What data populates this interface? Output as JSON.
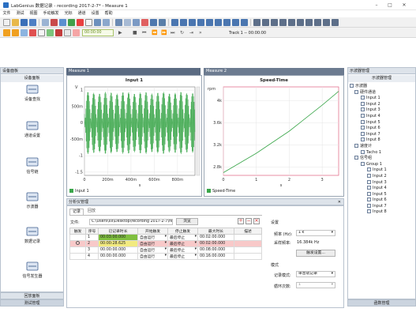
{
  "window": {
    "title": "LabGenius 数据记录 - recording 2017-2-7* - Measure 1"
  },
  "menu": [
    "文件",
    "测试",
    "视图",
    "手动触发",
    "光标",
    "通道",
    "设置",
    "帮助"
  ],
  "toolbar": {
    "timer_value": "00:00:00",
    "track_label": "Track 1 -- 00:00:00"
  },
  "left_panel": {
    "header": "设备面板",
    "title": "设备面板",
    "items": [
      {
        "label": "设备查找",
        "icon": "device-search-icon"
      },
      {
        "label": "通道设置",
        "icon": "channel-settings-icon"
      },
      {
        "label": "信号链",
        "icon": "signal-chain-icon"
      },
      {
        "label": "示波器",
        "icon": "oscilloscope-icon"
      },
      {
        "label": "数据记录",
        "icon": "data-recorder-icon"
      },
      {
        "label": "信号发生器",
        "icon": "signal-generator-icon"
      }
    ],
    "bottom_tabs": [
      "回放面板",
      "测试管理"
    ]
  },
  "plot1": {
    "tab": "Measure 1",
    "title": "Input 1",
    "yunit": "V",
    "xlabel": "s",
    "legend": "Input 1",
    "yticks": [
      "1",
      "500m",
      "0",
      "-500m",
      "-1",
      "-1.5"
    ],
    "xticks": [
      "0",
      "200m",
      "400m",
      "600m",
      "800m"
    ]
  },
  "plot2": {
    "tab": "Measure 2",
    "title": "Speed-Time",
    "yunit": "rpm",
    "xlabel": "s",
    "legend": "Speed-Time",
    "yticks": [
      "4k",
      "3.6k",
      "3.2k",
      "2.8k"
    ],
    "xticks": [
      "0",
      "1",
      "2",
      "3"
    ]
  },
  "chart_data": [
    {
      "type": "line",
      "title": "Input 1",
      "ylabel": "V",
      "xlabel": "s",
      "series": [
        {
          "name": "Input 1",
          "color": "#3aa64a"
        }
      ],
      "description_values": {
        "amplitude": 0.95,
        "x": [
          0,
          0.95
        ]
      },
      "xlim": [
        0,
        0.95
      ],
      "ylim": [
        -1.6,
        1.1
      ],
      "grid": true,
      "legend_position": "bottom-left"
    },
    {
      "type": "line",
      "title": "Speed-Time",
      "ylabel": "rpm",
      "xlabel": "s",
      "series": [
        {
          "name": "Speed-Time",
          "color": "#3aa64a",
          "x": [
            0,
            1,
            2,
            3,
            3.5
          ],
          "values": [
            2700,
            3050,
            3450,
            3920,
            4170
          ]
        }
      ],
      "xlim": [
        0,
        3.5
      ],
      "ylim": [
        2650,
        4250
      ],
      "grid": true,
      "legend_position": "bottom-left"
    }
  ],
  "analysis": {
    "header": "分析仪管理",
    "tabs": [
      "记录",
      "回放"
    ],
    "file_label": "文件:",
    "file_path": "C:\\Users\\xx\\Desktop\\recording 2017-2-7\\record",
    "browse_label": "浏览",
    "columns": [
      "触发",
      "序号",
      "已记录时长",
      "开始触发",
      "停止触发",
      "最大时长",
      "描述"
    ],
    "rows": [
      {
        "no": "1",
        "recorded": "00:03:00.000",
        "start": "自由运行",
        "stop": "最后停止",
        "max": "00:02:00.000",
        "desc": ""
      },
      {
        "no": "2",
        "recorded": "00:00:28.625",
        "start": "自由运行",
        "stop": "最后停止",
        "max": "00:02:00.000",
        "desc": ""
      },
      {
        "no": "3",
        "recorded": "00:00:00.000",
        "start": "自由运行",
        "stop": "最后停止",
        "max": "00:08:00.000",
        "desc": ""
      },
      {
        "no": "4",
        "recorded": "00:00:00.000",
        "start": "自由运行",
        "stop": "最后停止",
        "max": "00:16:00.000",
        "desc": ""
      }
    ]
  },
  "settings": {
    "section1": "设置",
    "freq_label": "频率 (Hz):",
    "freq_value": "1 k",
    "sample_label": "采样频率:",
    "sample_value": "16.384k Hz",
    "channel_btn": "触发设置...",
    "section2": "模式",
    "mode_label": "记录模式:",
    "mode_value": "单音轨记录",
    "loop_label": "循环次数:",
    "loop_value": "1"
  },
  "right_panel": {
    "header": "示波器管理",
    "title": "示波器管理",
    "root": "示波器",
    "hw_group": "硬件通道",
    "hw_inputs": [
      "Input 1",
      "Input 2",
      "Input 3",
      "Input 4",
      "Input 5",
      "Input 6",
      "Input 7",
      "Input 8"
    ],
    "speed_group": "速度计",
    "tacho": "Tacho 1",
    "sig_group": "信号组",
    "group": "Group 1",
    "grp_inputs": [
      "Input 1",
      "Input 2",
      "Input 3",
      "Input 4",
      "Input 5",
      "Input 6",
      "Input 7",
      "Input 8"
    ],
    "bottom_tab": "函数管理"
  }
}
